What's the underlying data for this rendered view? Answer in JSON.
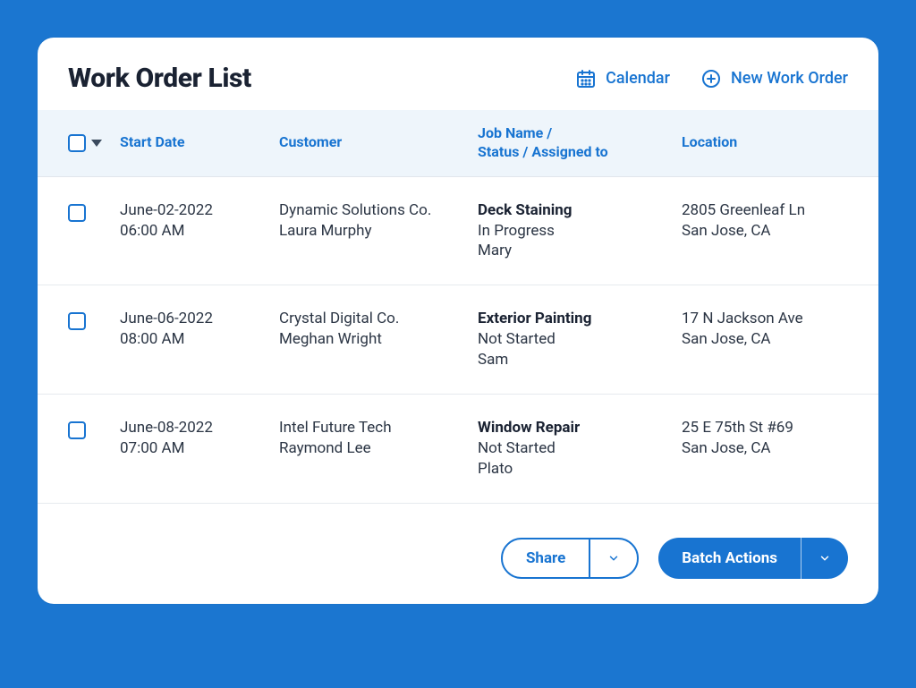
{
  "title": "Work Order List",
  "header_actions": {
    "calendar": "Calendar",
    "new_work_order": "New Work Order"
  },
  "columns": {
    "start_date": "Start Date",
    "customer": "Customer",
    "job": "Job Name /\nStatus / Assigned to",
    "location": "Location"
  },
  "rows": [
    {
      "date": "June-02-2022",
      "time": "06:00 AM",
      "company": "Dynamic Solutions Co.",
      "contact": "Laura Murphy",
      "job_name": "Deck Staining",
      "status": "In Progress",
      "assigned": "Mary",
      "address1": "2805 Greenleaf Ln",
      "address2": "San Jose, CA"
    },
    {
      "date": "June-06-2022",
      "time": "08:00 AM",
      "company": "Crystal Digital Co.",
      "contact": "Meghan Wright",
      "job_name": "Exterior Painting",
      "status": "Not Started",
      "assigned": "Sam",
      "address1": "17 N Jackson Ave",
      "address2": "San Jose, CA"
    },
    {
      "date": "June-08-2022",
      "time": "07:00 AM",
      "company": "Intel Future Tech",
      "contact": "Raymond Lee",
      "job_name": "Window Repair",
      "status": "Not Started",
      "assigned": "Plato",
      "address1": "25 E 75th St #69",
      "address2": "San Jose, CA"
    }
  ],
  "footer": {
    "share": "Share",
    "batch": "Batch Actions"
  }
}
